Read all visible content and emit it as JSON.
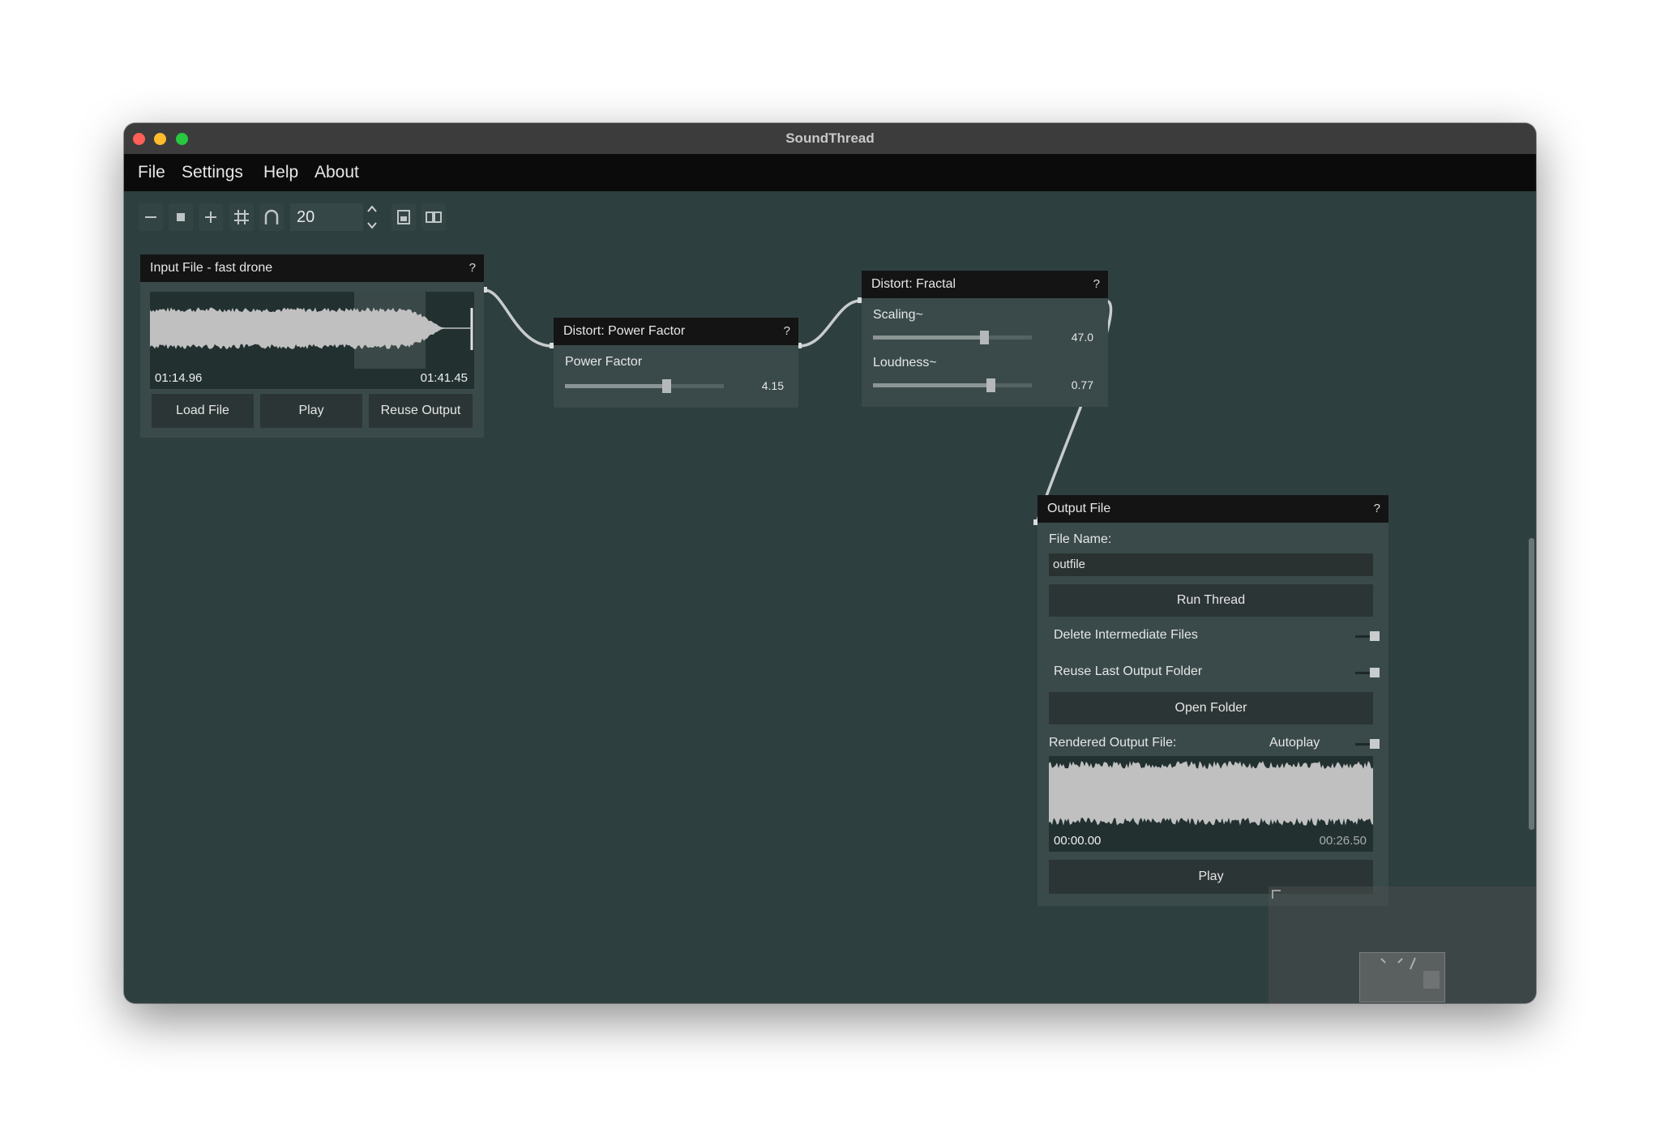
{
  "window": {
    "title": "SoundThread"
  },
  "menu": {
    "items": [
      "File",
      "Settings",
      "Help",
      "About"
    ]
  },
  "toolbar": {
    "zoom_value": "20",
    "icons": [
      "zoom-out-icon",
      "zoom-reset-icon",
      "zoom-in-icon",
      "grid-toggle-icon",
      "connection-curve-icon",
      "minimap-toggle-icon",
      "arrange-icon"
    ]
  },
  "nodes": {
    "input": {
      "title": "Input File - fast drone",
      "help": "?",
      "start_time": "01:14.96",
      "end_time": "01:41.45",
      "buttons": {
        "load": "Load File",
        "play": "Play",
        "reuse": "Reuse Output"
      }
    },
    "power_factor": {
      "title": "Distort: Power Factor",
      "help": "?",
      "param": {
        "label": "Power Factor",
        "value": "4.15",
        "level": 0.64
      }
    },
    "fractal": {
      "title": "Distort: Fractal",
      "help": "?",
      "params": [
        {
          "label": "Scaling~",
          "value": "47.0",
          "level": 0.7
        },
        {
          "label": "Loudness~",
          "value": "0.77",
          "level": 0.74
        }
      ]
    },
    "output": {
      "title": "Output File",
      "help": "?",
      "file_name_label": "File Name:",
      "file_name_value": "outfile",
      "run_button": "Run Thread",
      "delete_label": "Delete Intermediate Files",
      "reuse_label": "Reuse Last Output Folder",
      "open_folder_button": "Open Folder",
      "rendered_label": "Rendered Output File:",
      "autoplay_label": "Autoplay",
      "start_time": "00:00.00",
      "end_time": "00:26.50",
      "play_button": "Play"
    }
  },
  "colors": {
    "canvas": "#2e3f40",
    "node_body": "#3a4a4a",
    "node_header": "#141414",
    "button": "#2c3535",
    "waveform": "#c0c0c0",
    "connection": "#c8cccc"
  }
}
